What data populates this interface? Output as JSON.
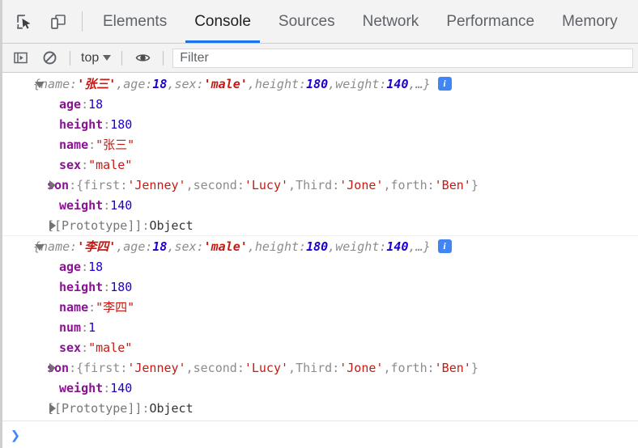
{
  "tabbar": {
    "icons": [
      {
        "name": "inspect-element-icon"
      },
      {
        "name": "device-toolbar-icon"
      }
    ],
    "tabs": [
      {
        "label": "Elements",
        "active": false
      },
      {
        "label": "Console",
        "active": true
      },
      {
        "label": "Sources",
        "active": false
      },
      {
        "label": "Network",
        "active": false
      },
      {
        "label": "Performance",
        "active": false
      },
      {
        "label": "Memory",
        "active": false
      }
    ]
  },
  "toolbar": {
    "sidebar_toggle_icon": "console-sidebar-icon",
    "clear_console_icon": "clear-console-icon",
    "context_value": "top",
    "live_expression_icon": "eye-icon",
    "filter_placeholder": "Filter",
    "filter_value": ""
  },
  "console": {
    "messages": [
      {
        "expanded": true,
        "preview": {
          "open": "{",
          "parts": [
            {
              "key": "name",
              "sep": ": ",
              "value": "'张三'",
              "type": "string",
              "comma": ", "
            },
            {
              "key": "age",
              "sep": ": ",
              "value": "18",
              "type": "number",
              "comma": ", "
            },
            {
              "key": "sex",
              "sep": ": ",
              "value": "'male'",
              "type": "string",
              "comma": ", "
            },
            {
              "key": "height",
              "sep": ": ",
              "value": "180",
              "type": "number",
              "comma": ", "
            },
            {
              "key": "weight",
              "sep": ": ",
              "value": "140",
              "type": "number",
              "comma": ", "
            }
          ],
          "ellipsis": "…",
          "close": "}",
          "badge": "i"
        },
        "properties": [
          {
            "kind": "prop",
            "key": "age",
            "value": "18",
            "type": "number"
          },
          {
            "kind": "prop",
            "key": "height",
            "value": "180",
            "type": "number"
          },
          {
            "kind": "prop",
            "key": "name",
            "value": "\"张三\"",
            "type": "string"
          },
          {
            "kind": "prop",
            "key": "sex",
            "value": "\"male\"",
            "type": "string"
          },
          {
            "kind": "subobj",
            "key": "son",
            "inline": [
              {
                "key": "first",
                "value": "'Jenney'",
                "comma": ", "
              },
              {
                "key": "second",
                "value": "'Lucy'",
                "comma": ", "
              },
              {
                "key": "Third",
                "value": "'Jone'",
                "comma": ", "
              },
              {
                "key": "forth",
                "value": "'Ben'",
                "comma": ""
              }
            ]
          },
          {
            "kind": "prop",
            "key": "weight",
            "value": "140",
            "type": "number"
          },
          {
            "kind": "proto",
            "key": "[[Prototype]]",
            "value": "Object"
          }
        ]
      },
      {
        "expanded": true,
        "preview": {
          "open": "{",
          "parts": [
            {
              "key": "name",
              "sep": ": ",
              "value": "'李四'",
              "type": "string",
              "comma": ", "
            },
            {
              "key": "age",
              "sep": ": ",
              "value": "18",
              "type": "number",
              "comma": ", "
            },
            {
              "key": "sex",
              "sep": ": ",
              "value": "'male'",
              "type": "string",
              "comma": ", "
            },
            {
              "key": "height",
              "sep": ": ",
              "value": "180",
              "type": "number",
              "comma": ", "
            },
            {
              "key": "weight",
              "sep": ": ",
              "value": "140",
              "type": "number",
              "comma": ", "
            }
          ],
          "ellipsis": "…",
          "close": "}",
          "badge": "i"
        },
        "properties": [
          {
            "kind": "prop",
            "key": "age",
            "value": "18",
            "type": "number"
          },
          {
            "kind": "prop",
            "key": "height",
            "value": "180",
            "type": "number"
          },
          {
            "kind": "prop",
            "key": "name",
            "value": "\"李四\"",
            "type": "string"
          },
          {
            "kind": "prop",
            "key": "num",
            "value": "1",
            "type": "number"
          },
          {
            "kind": "prop",
            "key": "sex",
            "value": "\"male\"",
            "type": "string"
          },
          {
            "kind": "subobj",
            "key": "son",
            "inline": [
              {
                "key": "first",
                "value": "'Jenney'",
                "comma": ", "
              },
              {
                "key": "second",
                "value": "'Lucy'",
                "comma": ", "
              },
              {
                "key": "Third",
                "value": "'Jone'",
                "comma": ", "
              },
              {
                "key": "forth",
                "value": "'Ben'",
                "comma": ""
              }
            ]
          },
          {
            "kind": "prop",
            "key": "weight",
            "value": "140",
            "type": "number"
          },
          {
            "kind": "proto",
            "key": "[[Prototype]]",
            "value": "Object"
          }
        ]
      }
    ]
  },
  "prompt": {
    "arrow": "❯"
  },
  "colors": {
    "accent": "#1a73e8",
    "badge": "#4285f4",
    "property_key": "#881391",
    "number": "#1c00cf",
    "string": "#c41a16",
    "punct": "#8c8c8c",
    "toolbar_bg": "#f3f3f3"
  }
}
